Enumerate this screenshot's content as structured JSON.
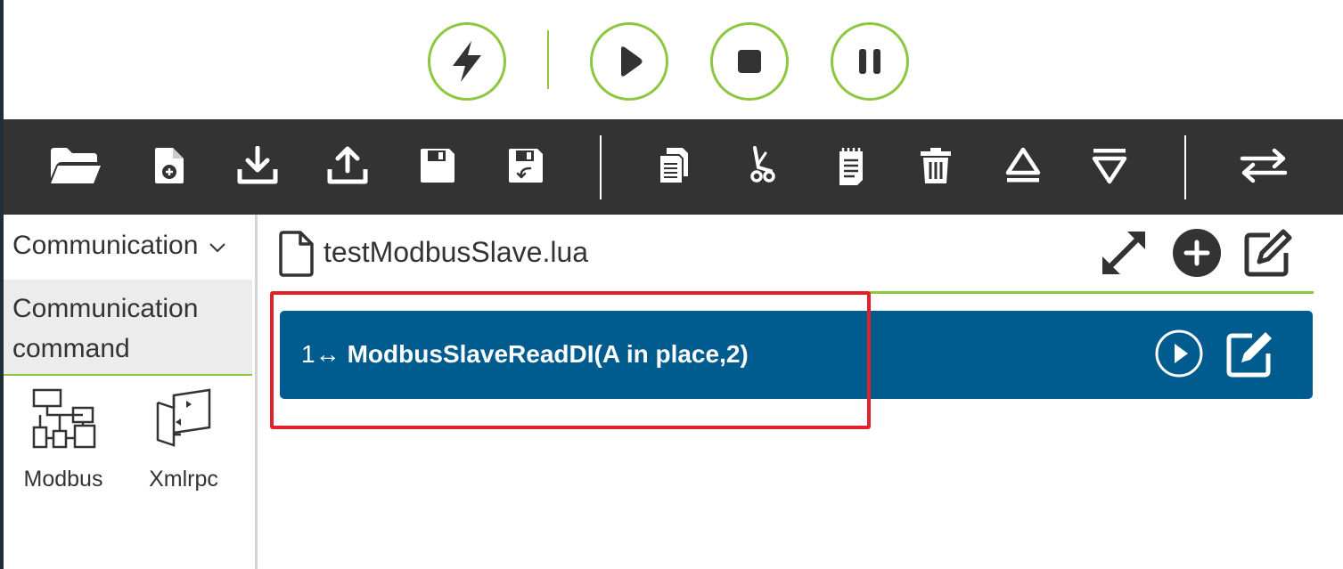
{
  "colors": {
    "accent": "#8dc63f",
    "toolbar_bg": "#333333",
    "command_bg": "#005c8f",
    "highlight": "#e0202a"
  },
  "run_controls": {
    "items": [
      {
        "icon": "lightning-icon"
      },
      {
        "icon": "play-icon"
      },
      {
        "icon": "stop-icon"
      },
      {
        "icon": "pause-icon"
      }
    ]
  },
  "toolbar": {
    "items": [
      {
        "icon": "folder-open-icon"
      },
      {
        "icon": "new-file-icon"
      },
      {
        "icon": "download-icon"
      },
      {
        "icon": "upload-icon"
      },
      {
        "icon": "save-icon"
      },
      {
        "icon": "save-as-icon"
      },
      {
        "icon": "copy-icon"
      },
      {
        "icon": "cut-icon"
      },
      {
        "icon": "paste-icon"
      },
      {
        "icon": "trash-icon"
      },
      {
        "icon": "move-up-icon"
      },
      {
        "icon": "move-down-icon"
      },
      {
        "icon": "swap-icon"
      }
    ]
  },
  "left_panel": {
    "category_select": "Communication",
    "active_category_line1": "Communication",
    "active_category_line2": "command",
    "tools": [
      {
        "label": "Modbus",
        "icon": "modbus-icon"
      },
      {
        "label": "Xmlrpc",
        "icon": "xmlrpc-icon"
      }
    ]
  },
  "editor": {
    "file_name": "testModbusSlave.lua",
    "header_icons": [
      "expand-icon",
      "add-icon",
      "edit-icon"
    ],
    "commands": [
      {
        "line": "1",
        "text": "ModbusSlaveReadDI(A in place,2)"
      }
    ]
  }
}
